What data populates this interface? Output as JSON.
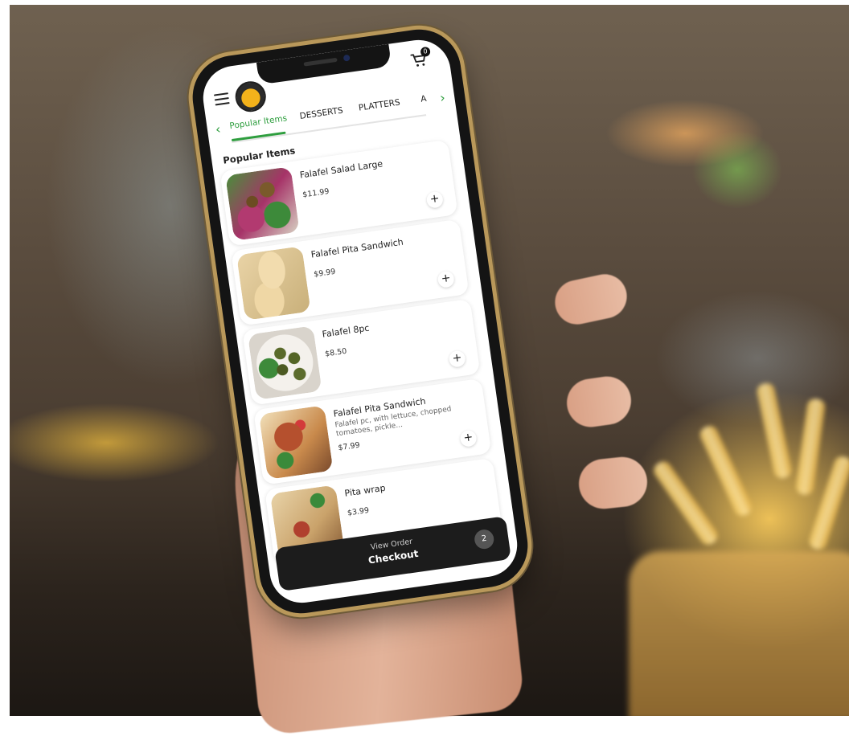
{
  "header": {
    "cart_count": "0"
  },
  "tabs": {
    "items": [
      "Popular Items",
      "DESSERTS",
      "PLATTERS",
      "A"
    ]
  },
  "section": {
    "title": "Popular Items"
  },
  "menu_items": [
    {
      "name": "Falafel Salad Large",
      "desc": "",
      "price": "$11.99",
      "image": "salad"
    },
    {
      "name": "Falafel Pita Sandwich",
      "desc": "",
      "price": "$9.99",
      "image": "pita"
    },
    {
      "name": "Falafel 8pc",
      "desc": "",
      "price": "$8.50",
      "image": "balls"
    },
    {
      "name": "Falafel Pita Sandwich",
      "desc": "Falafel pc, with lettuce, chopped tomatoes, pickle...",
      "price": "$7.99",
      "image": "wrap"
    },
    {
      "name": "Pita wrap",
      "desc": "",
      "price": "$3.99",
      "image": "pitawrap"
    }
  ],
  "checkout": {
    "subtitle": "View Order",
    "label": "Checkout",
    "count": "2"
  },
  "colors": {
    "accent": "#2e9e3e",
    "checkout_bg": "#1c1c1c"
  }
}
